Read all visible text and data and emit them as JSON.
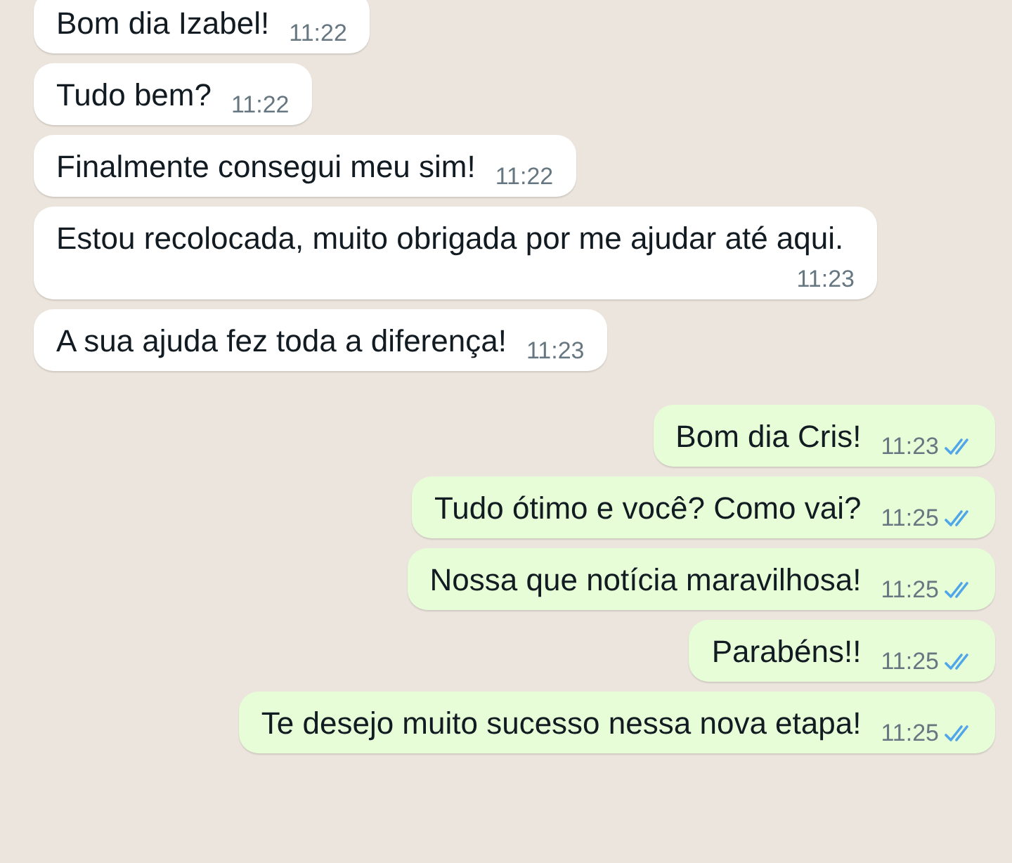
{
  "messages": [
    {
      "kind": "incoming",
      "text": "Bom dia Izabel!",
      "time": "11:22"
    },
    {
      "kind": "incoming",
      "text": "Tudo bem?",
      "time": "11:22"
    },
    {
      "kind": "incoming",
      "text": "Finalmente consegui meu sim!",
      "time": "11:22"
    },
    {
      "kind": "incoming",
      "text": "Estou recolocada, muito obrigada por me ajudar até aqui.",
      "time": "11:23"
    },
    {
      "kind": "incoming",
      "text": "A sua ajuda fez toda a diferença!",
      "time": "11:23"
    },
    {
      "kind": "outgoing",
      "text": "Bom dia Cris!",
      "time": "11:23",
      "read": true
    },
    {
      "kind": "outgoing",
      "text": "Tudo ótimo e você? Como vai?",
      "time": "11:25",
      "read": true
    },
    {
      "kind": "outgoing",
      "text": "Nossa que notícia maravilhosa!",
      "time": "11:25",
      "read": true
    },
    {
      "kind": "outgoing",
      "text": "Parabéns!!",
      "time": "11:25",
      "read": true
    },
    {
      "kind": "outgoing",
      "text": "Te desejo muito sucesso nessa nova etapa!",
      "time": "11:25",
      "read": true
    }
  ]
}
